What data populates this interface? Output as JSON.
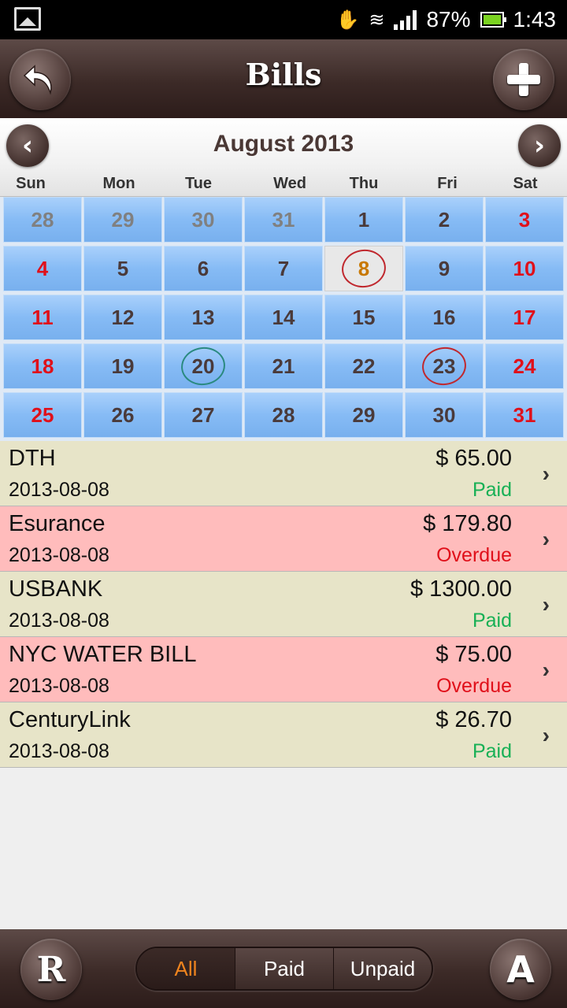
{
  "status_bar": {
    "battery_percent": "87%",
    "time": "1:43"
  },
  "header": {
    "title": "Bills",
    "back_icon": "back-arrow-icon",
    "add_icon": "plus-icon"
  },
  "calendar": {
    "month_label": "August 2013",
    "prev_icon": "chevron-left-icon",
    "next_icon": "chevron-right-icon",
    "weekdays": [
      "Sun",
      "Mon",
      "Tue",
      "Wed",
      "Thu",
      "Fri",
      "Sat"
    ],
    "weeks": [
      [
        {
          "d": "28",
          "type": "other"
        },
        {
          "d": "29",
          "type": "other"
        },
        {
          "d": "30",
          "type": "other"
        },
        {
          "d": "31",
          "type": "other"
        },
        {
          "d": "1",
          "type": "normal"
        },
        {
          "d": "2",
          "type": "normal"
        },
        {
          "d": "3",
          "type": "weekend"
        }
      ],
      [
        {
          "d": "4",
          "type": "weekend"
        },
        {
          "d": "5",
          "type": "normal"
        },
        {
          "d": "6",
          "type": "normal"
        },
        {
          "d": "7",
          "type": "normal"
        },
        {
          "d": "8",
          "type": "today",
          "mark": "red"
        },
        {
          "d": "9",
          "type": "normal"
        },
        {
          "d": "10",
          "type": "weekend"
        }
      ],
      [
        {
          "d": "11",
          "type": "weekend"
        },
        {
          "d": "12",
          "type": "normal"
        },
        {
          "d": "13",
          "type": "normal"
        },
        {
          "d": "14",
          "type": "normal"
        },
        {
          "d": "15",
          "type": "normal"
        },
        {
          "d": "16",
          "type": "normal"
        },
        {
          "d": "17",
          "type": "weekend"
        }
      ],
      [
        {
          "d": "18",
          "type": "weekend"
        },
        {
          "d": "19",
          "type": "normal"
        },
        {
          "d": "20",
          "type": "normal",
          "mark": "teal"
        },
        {
          "d": "21",
          "type": "normal"
        },
        {
          "d": "22",
          "type": "normal"
        },
        {
          "d": "23",
          "type": "normal",
          "mark": "red"
        },
        {
          "d": "24",
          "type": "weekend"
        }
      ],
      [
        {
          "d": "25",
          "type": "weekend"
        },
        {
          "d": "26",
          "type": "normal"
        },
        {
          "d": "27",
          "type": "normal"
        },
        {
          "d": "28",
          "type": "normal"
        },
        {
          "d": "29",
          "type": "normal"
        },
        {
          "d": "30",
          "type": "normal"
        },
        {
          "d": "31",
          "type": "weekend"
        }
      ]
    ]
  },
  "bills": [
    {
      "name": "DTH",
      "date": "2013-08-08",
      "amount": "$ 65.00",
      "status": "Paid",
      "state": "paid"
    },
    {
      "name": "Esurance",
      "date": "2013-08-08",
      "amount": "$ 179.80",
      "status": "Overdue",
      "state": "overdue"
    },
    {
      "name": "USBANK",
      "date": "2013-08-08",
      "amount": "$ 1300.00",
      "status": "Paid",
      "state": "paid"
    },
    {
      "name": "NYC WATER BILL",
      "date": "2013-08-08",
      "amount": "$ 75.00",
      "status": "Overdue",
      "state": "overdue"
    },
    {
      "name": "CenturyLink",
      "date": "2013-08-08",
      "amount": "$ 26.70",
      "status": "Paid",
      "state": "paid"
    }
  ],
  "bill_chevron": "›",
  "bottom_bar": {
    "left_button": "R",
    "right_button": "A",
    "filters": [
      {
        "label": "All",
        "active": true
      },
      {
        "label": "Paid",
        "active": false
      },
      {
        "label": "Unpaid",
        "active": false
      }
    ]
  },
  "colors": {
    "header_bg": "#3c2a27",
    "paid_row": "#e7e4c8",
    "overdue_row": "#ffbcbc",
    "paid_text": "#17b055",
    "overdue_text": "#e0101a",
    "weekend_text": "#e0101a",
    "today_text": "#c87800",
    "active_filter": "#f0841e"
  }
}
